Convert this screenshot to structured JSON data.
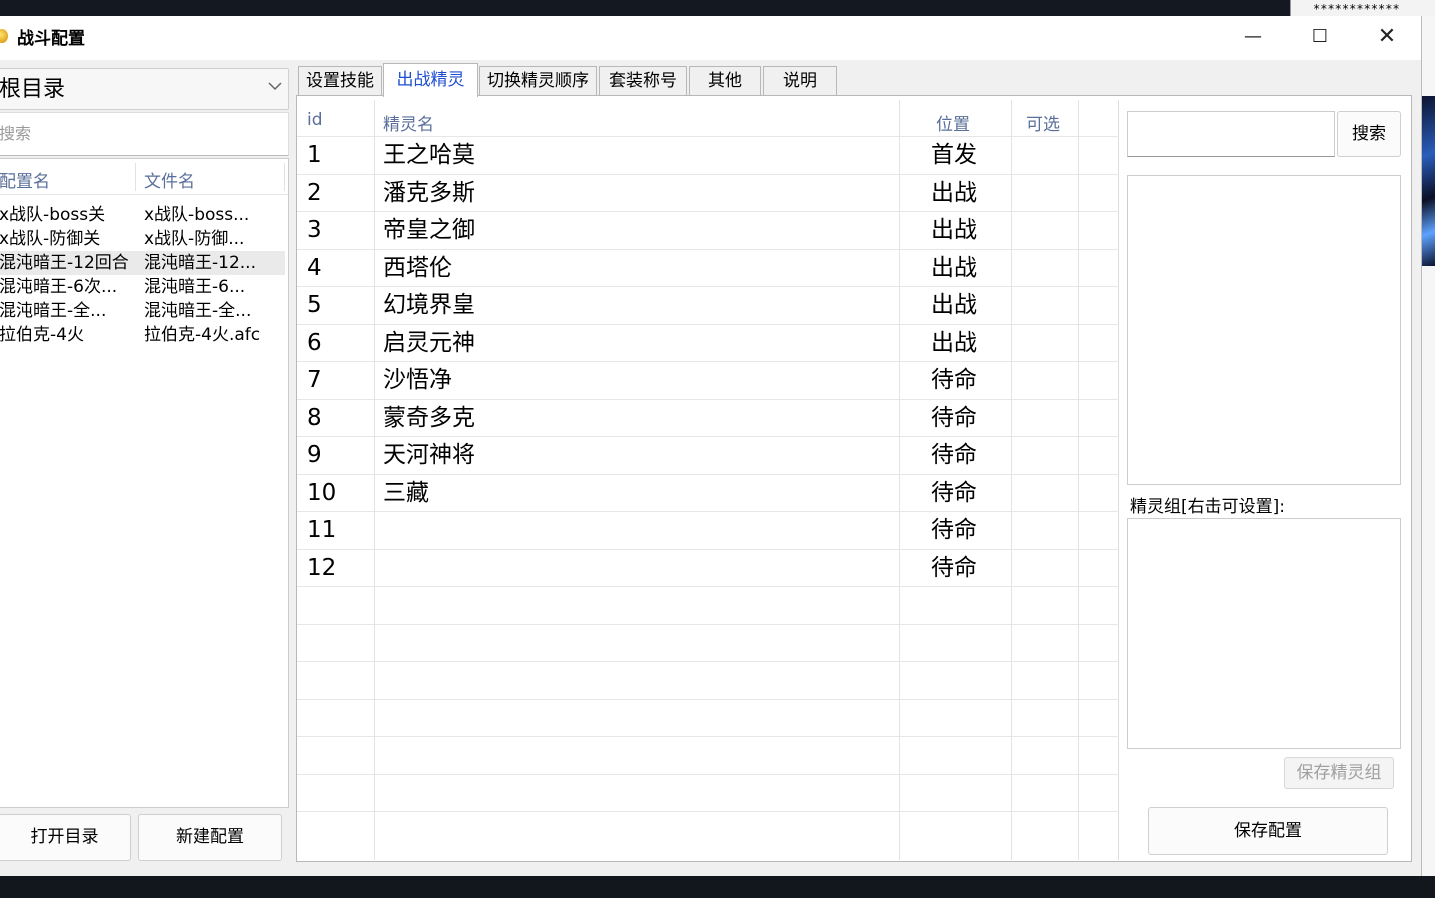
{
  "background": {
    "top_right_text": "************"
  },
  "window": {
    "title": "战斗配置",
    "controls": {
      "minimize": "—",
      "maximize": "☐",
      "close": "✕"
    }
  },
  "left_panel": {
    "directory_select": {
      "value": "根目录"
    },
    "search": {
      "placeholder": "搜索"
    },
    "columns": [
      "配置名",
      "文件名"
    ],
    "rows": [
      {
        "name": "x战队-boss关",
        "file": "x战队-boss..."
      },
      {
        "name": "x战队-防御关",
        "file": "x战队-防御..."
      },
      {
        "name": "混沌暗王-12回合",
        "file": "混沌暗王-12..."
      },
      {
        "name": "混沌暗王-6次...",
        "file": "混沌暗王-6..."
      },
      {
        "name": "混沌暗王-全...",
        "file": "混沌暗王-全..."
      },
      {
        "name": "拉伯克-4火",
        "file": "拉伯克-4火.afc"
      }
    ],
    "selected_index": 2,
    "buttons": {
      "open_dir": "打开目录",
      "new_config": "新建配置"
    }
  },
  "tabs": [
    {
      "label": "设置技能",
      "active": false
    },
    {
      "label": "出战精灵",
      "active": true
    },
    {
      "label": "切换精灵顺序",
      "active": false
    },
    {
      "label": "套装称号",
      "active": false
    },
    {
      "label": "其他",
      "active": false
    },
    {
      "label": "说明",
      "active": false
    }
  ],
  "sprite_table": {
    "columns": {
      "id": "id",
      "name": "精灵名",
      "position": "位置",
      "optional": "可选"
    },
    "rows": [
      {
        "id": "1",
        "name": "王之哈莫",
        "position": "首发"
      },
      {
        "id": "2",
        "name": "潘克多斯",
        "position": "出战"
      },
      {
        "id": "3",
        "name": "帝皇之御",
        "position": "出战"
      },
      {
        "id": "4",
        "name": "西塔伦",
        "position": "出战"
      },
      {
        "id": "5",
        "name": "幻境界皇",
        "position": "出战"
      },
      {
        "id": "6",
        "name": "启灵元神",
        "position": "出战"
      },
      {
        "id": "7",
        "name": "沙悟净",
        "position": "待命"
      },
      {
        "id": "8",
        "name": "蒙奇多克",
        "position": "待命"
      },
      {
        "id": "9",
        "name": "天河神将",
        "position": "待命"
      },
      {
        "id": "10",
        "name": "三藏",
        "position": "待命"
      },
      {
        "id": "11",
        "name": "",
        "position": "待命"
      },
      {
        "id": "12",
        "name": "",
        "position": "待命"
      }
    ]
  },
  "right_panel": {
    "search_value": "",
    "search_button": "搜索",
    "group_label": "精灵组[右击可设置]:",
    "save_group_button": "保存精灵组",
    "save_config_button": "保存配置"
  }
}
